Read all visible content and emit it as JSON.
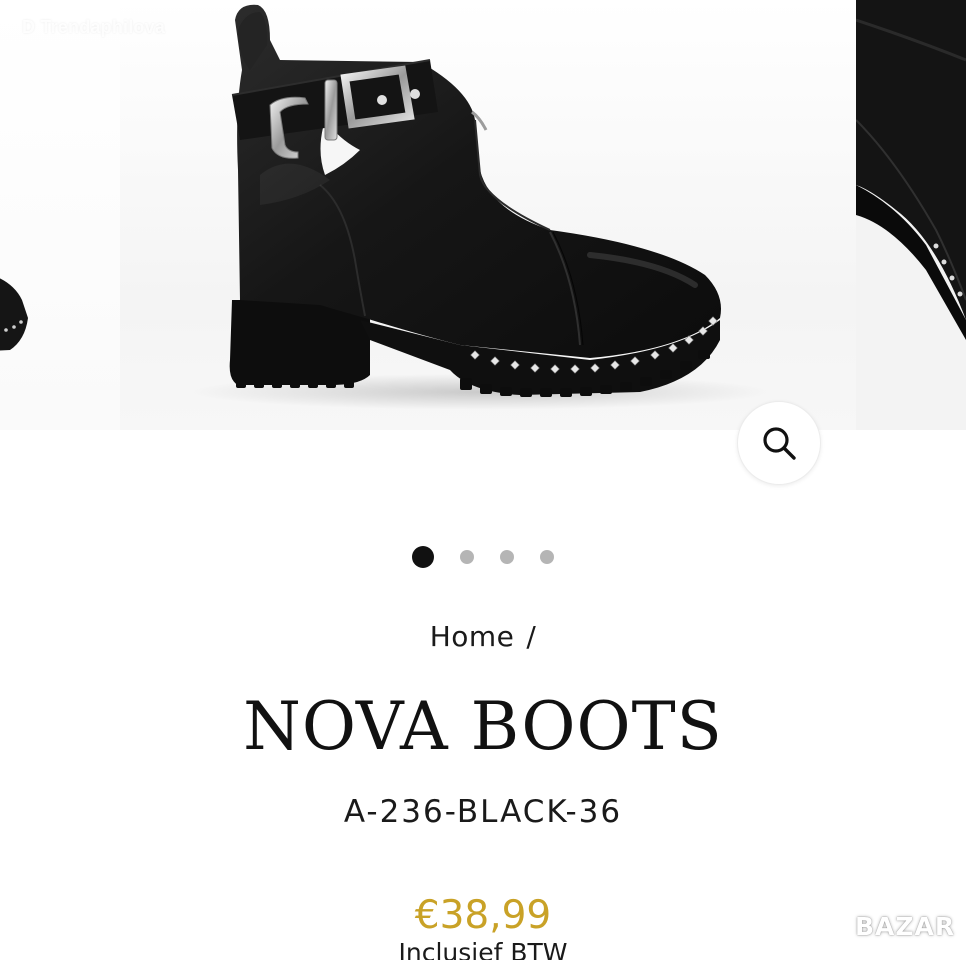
{
  "watermark": "D Trendaphilova",
  "gallery": {
    "slide_count": 4,
    "active_slide": 1,
    "zoom_icon": "search-icon"
  },
  "breadcrumb": {
    "home_label": "Home",
    "separator": "/"
  },
  "product": {
    "title": "NOVA BOOTS",
    "sku": "A-236-BLACK-36",
    "price": "€38,99",
    "tax_note": "Inclusief BTW"
  },
  "app_logo": "BAZAR",
  "colors": {
    "price": "#c9a227",
    "dot_active": "#111111",
    "dot_inactive": "#b5b5b5",
    "text": "#1a1a1a"
  }
}
